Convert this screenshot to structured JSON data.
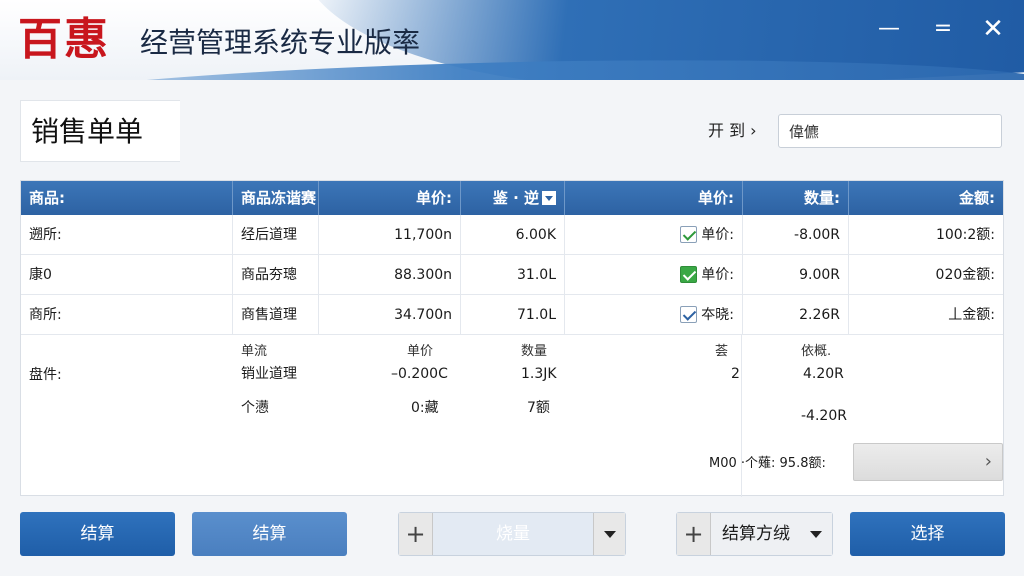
{
  "app": {
    "brand": "百惠",
    "title": "经营管理系统专业版率"
  },
  "window_controls": {
    "minimize": "—",
    "maximize": "=",
    "close": "✕"
  },
  "page": {
    "title": "销售单单",
    "date_label": "开  到 ›",
    "search_value": "偉儦"
  },
  "table": {
    "headers": [
      "商品:",
      "商品冻谐赛",
      "单价:",
      "鉴 · 逆",
      "单价:",
      "数量:",
      "金额:"
    ],
    "rows": [
      {
        "c0": "遡所:",
        "c1": "经后道理",
        "c2": "11,700n",
        "c3": "6.00K",
        "check": "checked",
        "c4": "单价:",
        "c5": "-8.00R",
        "c6": "100:2额:"
      },
      {
        "c0": "康0",
        "c1": "商品夯璁",
        "c2": "88.300n",
        "c3": "31.0L",
        "check": "green",
        "c4": "单价:",
        "c5": "9.00R",
        "c6": "020金额:"
      },
      {
        "c0": "商所:",
        "c1": "商售道理",
        "c2": "34.700n",
        "c3": "71.0L",
        "check": "blue",
        "c4": "夲晓:",
        "c5": "2.26R",
        "c6": "丄金额:"
      }
    ],
    "sub": {
      "label": "盘件:",
      "h1": "单流",
      "h2": "单价",
      "h3": "数量",
      "h4": "荟",
      "h5": "依概.",
      "r1c1": "销业道理",
      "r1c2": "–0.200C",
      "r1c3": "1.3JK",
      "r1c4": "2",
      "r1c5": "4.20R",
      "r2c1": "个懑",
      "r2c2": "0:藏",
      "r2c3": "7额",
      "r2c5": "-4.20R",
      "total": "M00 ·个薙:  95.8额:",
      "pager_arrow": "›"
    }
  },
  "toolbar": {
    "settle_primary": "结算",
    "settle_secondary": "结算",
    "combo1_plus": "+",
    "combo1_label": "烧量",
    "combo2_plus": "+",
    "combo2_label": "结算方绒",
    "select": "选择"
  },
  "colors": {
    "brand_red": "#c8161d",
    "header_blue": "#2d62a3",
    "button_blue": "#1f5ea8"
  }
}
